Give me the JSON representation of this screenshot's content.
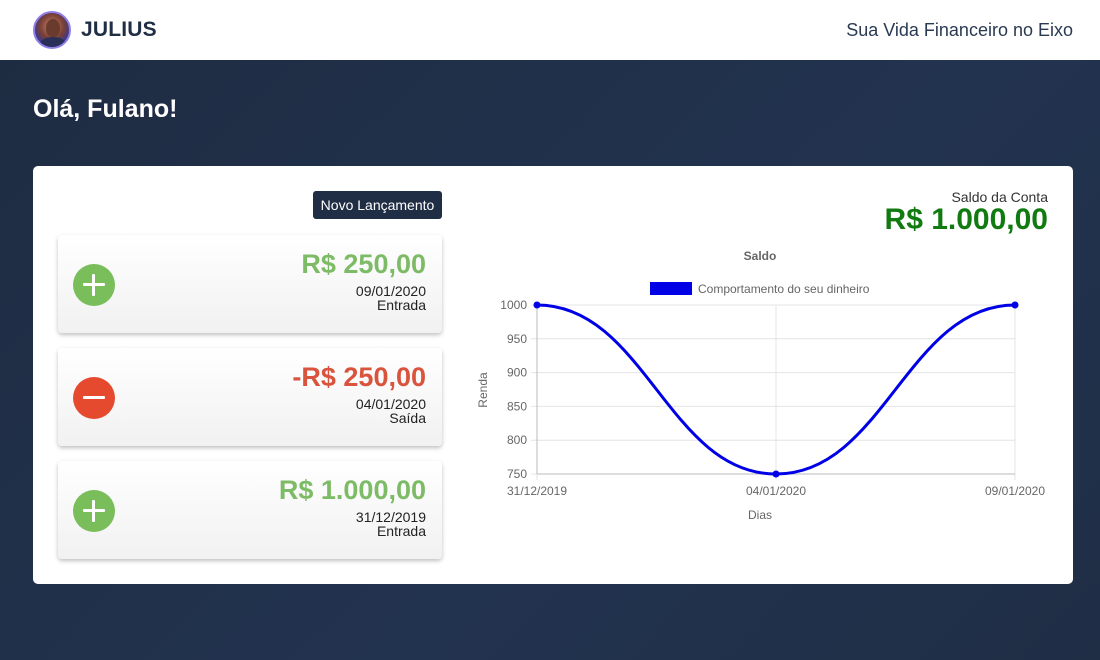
{
  "header": {
    "brand": "JULIUS",
    "tagline": "Sua Vida Financeiro no Eixo"
  },
  "greeting": "Olá, Fulano!",
  "actions": {
    "new_entry_label": "Novo Lançamento"
  },
  "transactions": [
    {
      "amount": "R$ 250,00",
      "date": "09/01/2020",
      "kind": "Entrada",
      "type": "in",
      "icon": "plus-icon"
    },
    {
      "amount": "-R$ 250,00",
      "date": "04/01/2020",
      "kind": "Saída",
      "type": "out",
      "icon": "minus-icon"
    },
    {
      "amount": "R$ 1.000,00",
      "date": "31/12/2019",
      "kind": "Entrada",
      "type": "in",
      "icon": "plus-icon"
    }
  ],
  "balance": {
    "label": "Saldo da Conta",
    "value": "R$ 1.000,00"
  },
  "colors": {
    "header_bg": "#ffffff",
    "page_bg": "#1f2e45",
    "income": "#79be5b",
    "expense": "#e54a2f",
    "balance": "#117a11",
    "series": "#0000e6"
  },
  "chart_data": {
    "type": "line",
    "title": "Saldo",
    "xlabel": "Dias",
    "ylabel": "Renda",
    "x": [
      "31/12/2019",
      "04/01/2020",
      "09/01/2020"
    ],
    "series": [
      {
        "name": "Comportamento do seu dinheiro",
        "values": [
          1000,
          750,
          1000
        ]
      }
    ],
    "ylim": [
      750,
      1000
    ],
    "yticks": [
      750,
      800,
      850,
      900,
      950,
      1000
    ],
    "grid": true,
    "legend": "top"
  }
}
